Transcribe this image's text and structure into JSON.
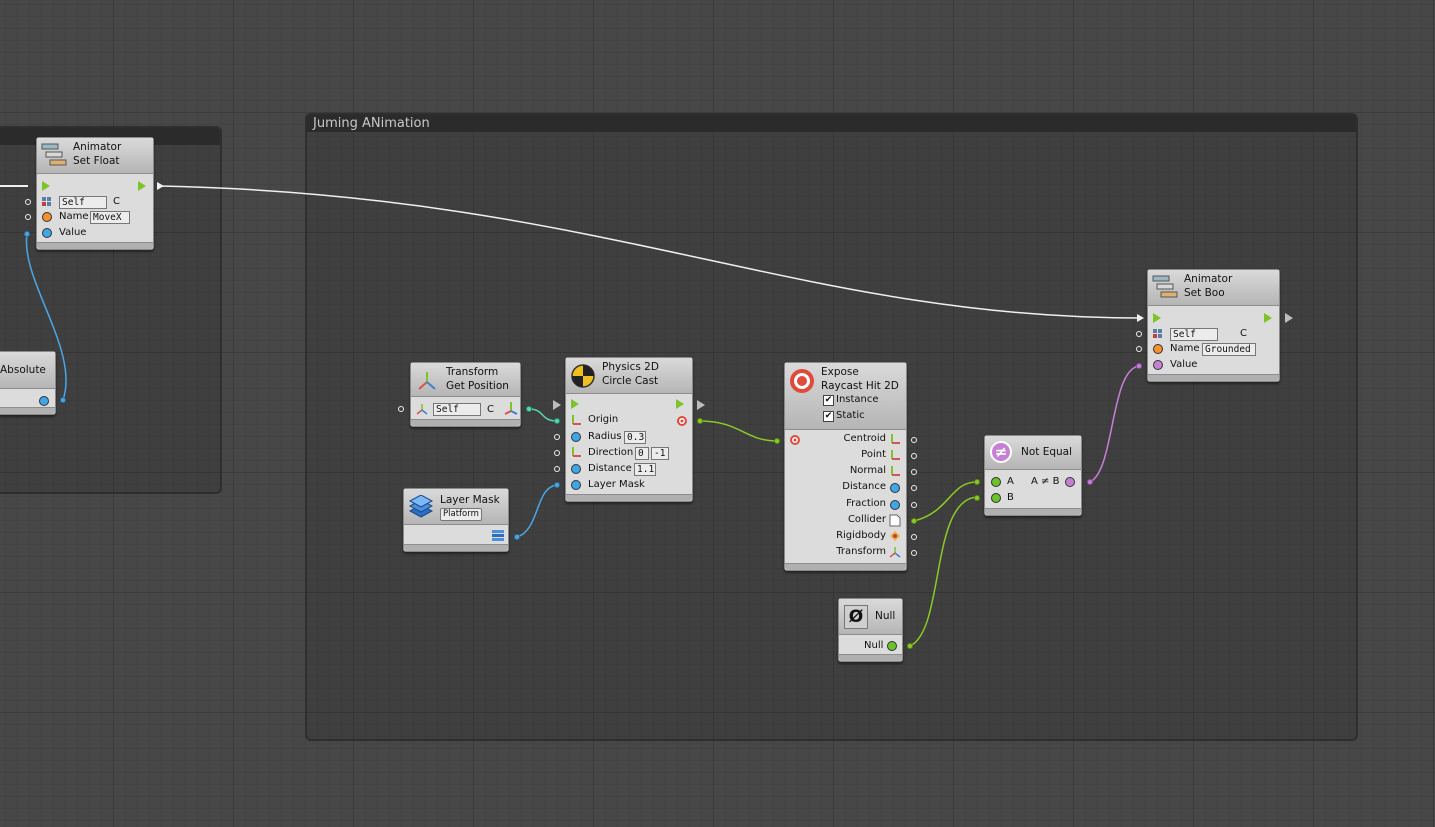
{
  "groups": [
    {
      "title": ""
    },
    {
      "title": "Juming ANimation"
    }
  ],
  "nodes": {
    "animator_set_float": {
      "title_line1": "Animator",
      "title_line2": "Set Float",
      "target": "Self",
      "name_label": "Name",
      "name_value": "MoveX",
      "value_label": "Value",
      "c_suffix": "C"
    },
    "absolute": {
      "title": "Absolute"
    },
    "transform_get_position": {
      "title_line1": "Transform",
      "title_line2": "Get Position",
      "target": "Self",
      "c_suffix": "C"
    },
    "circle_cast": {
      "title_line1": "Physics 2D",
      "title_line2": "Circle Cast",
      "origin_label": "Origin",
      "radius_label": "Radius",
      "radius_value": "0.3",
      "direction_label": "Direction",
      "direction_x": "0",
      "direction_y": "-1",
      "distance_label": "Distance",
      "distance_value": "1.1",
      "layermask_label": "Layer Mask"
    },
    "layer_mask": {
      "title": "Layer Mask",
      "dropdown": "Platform"
    },
    "expose_raycast": {
      "title_line1": "Expose",
      "title_line2": "Raycast Hit 2D",
      "instance_label": "Instance",
      "static_label": "Static",
      "outputs": [
        "Centroid",
        "Point",
        "Normal",
        "Distance",
        "Fraction",
        "Collider",
        "Rigidbody",
        "Transform"
      ]
    },
    "null_node": {
      "title": "Null",
      "out_label": "Null",
      "glyph": "Ø"
    },
    "not_equal": {
      "title": "Not Equal",
      "a_label": "A",
      "b_label": "B",
      "out_label": "A ≠ B",
      "glyph": "≠"
    },
    "animator_set_bool": {
      "title_line1": "Animator",
      "title_line2": "Set Boo",
      "target": "Self",
      "name_label": "Name",
      "name_value": "Grounded",
      "value_label": "Value",
      "c_suffix": "C"
    }
  },
  "colors": {
    "float_pin": "#3ea7e8",
    "string_pin": "#f5902e",
    "object_pin": "#6bc22a",
    "bool_pin": "#c77fd6",
    "flow_arrow": "#7cc42a"
  }
}
